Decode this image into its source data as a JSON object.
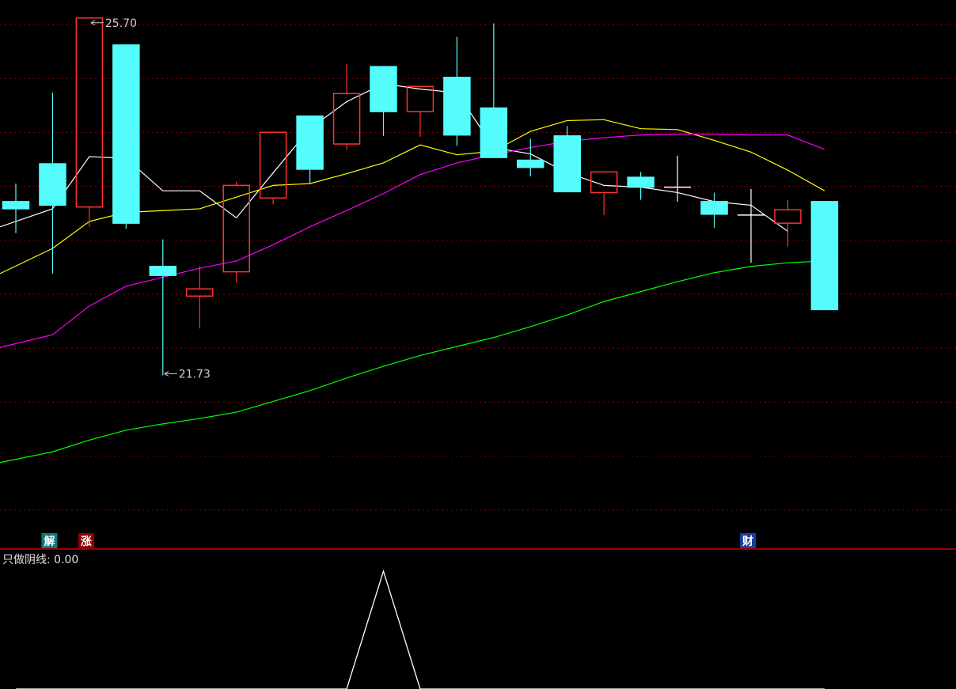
{
  "chart_data": {
    "type": "candlestick",
    "title": "",
    "ylim": [
      19.8,
      25.9
    ],
    "grid": true,
    "colors": {
      "up": "#ff3232",
      "down": "#54fcfc",
      "doji": "#ffffff",
      "ma5": "#ffffff",
      "ma10": "#ffff00",
      "ma20": "#ff00ff",
      "ma60": "#00ff00",
      "grid": "#8b0000",
      "separator": "#c80000",
      "indicator": "#ffffff"
    },
    "candles": [
      {
        "open": 23.66,
        "close": 23.58,
        "high": 23.86,
        "low": 23.31
      },
      {
        "open": 24.08,
        "close": 23.62,
        "high": 24.87,
        "low": 22.86
      },
      {
        "open": 23.6,
        "close": 25.7,
        "high": 25.7,
        "low": 23.38
      },
      {
        "open": 25.4,
        "close": 23.42,
        "high": 25.4,
        "low": 23.36
      },
      {
        "open": 22.94,
        "close": 22.84,
        "high": 23.24,
        "low": 21.73
      },
      {
        "open": 22.61,
        "close": 22.69,
        "high": 22.94,
        "low": 22.25
      },
      {
        "open": 22.88,
        "close": 23.84,
        "high": 23.88,
        "low": 22.76
      },
      {
        "open": 23.7,
        "close": 24.43,
        "high": 24.43,
        "low": 23.63
      },
      {
        "open": 24.61,
        "close": 24.02,
        "high": 24.61,
        "low": 23.86
      },
      {
        "open": 24.3,
        "close": 24.86,
        "high": 25.19,
        "low": 24.24
      },
      {
        "open": 25.16,
        "close": 24.66,
        "high": 25.16,
        "low": 24.39
      },
      {
        "open": 24.66,
        "close": 24.94,
        "high": 24.94,
        "low": 24.38
      },
      {
        "open": 25.04,
        "close": 24.4,
        "high": 25.49,
        "low": 24.28
      },
      {
        "open": 24.7,
        "close": 24.15,
        "high": 25.64,
        "low": 24.15
      },
      {
        "open": 24.12,
        "close": 24.04,
        "high": 24.36,
        "low": 23.94
      },
      {
        "open": 24.39,
        "close": 23.77,
        "high": 24.5,
        "low": 23.77
      },
      {
        "open": 23.76,
        "close": 23.99,
        "high": 23.99,
        "low": 23.51
      },
      {
        "open": 23.93,
        "close": 23.82,
        "high": 23.99,
        "low": 23.68
      },
      {
        "open": 23.82,
        "close": 23.82,
        "high": 24.17,
        "low": 23.66
      },
      {
        "open": 23.66,
        "close": 23.52,
        "high": 23.76,
        "low": 23.37
      },
      {
        "open": 23.51,
        "close": 23.51,
        "high": 23.8,
        "low": 22.98
      },
      {
        "open": 23.42,
        "close": 23.57,
        "high": 23.68,
        "low": 23.16
      },
      {
        "open": 23.66,
        "close": 22.46,
        "high": 23.66,
        "low": 22.46
      }
    ],
    "series": [
      {
        "key": "ma5",
        "values": [
          23.38,
          23.58,
          24.16,
          24.14,
          23.78,
          23.78,
          23.48,
          23.98,
          24.47,
          24.77,
          24.97,
          24.91,
          24.87,
          24.26,
          24.19,
          23.98,
          23.84,
          23.82,
          23.76,
          23.66,
          23.62,
          23.33
        ]
      },
      {
        "key": "ma10",
        "values": [
          22.86,
          23.14,
          23.44,
          23.54,
          23.56,
          23.58,
          23.71,
          23.84,
          23.86,
          23.97,
          24.09,
          24.29,
          24.18,
          24.22,
          24.44,
          24.56,
          24.57,
          24.47,
          24.46,
          24.34,
          24.21,
          24.01,
          23.78
        ]
      },
      {
        "key": "ma20",
        "values": [
          22.04,
          22.18,
          22.5,
          22.72,
          22.82,
          22.92,
          23.0,
          23.18,
          23.38,
          23.56,
          23.75,
          23.96,
          24.09,
          24.18,
          24.26,
          24.33,
          24.37,
          24.4,
          24.41,
          24.41,
          24.4,
          24.4,
          24.24
        ]
      },
      {
        "key": "ma60",
        "values": [
          20.76,
          20.88,
          21.01,
          21.12,
          21.19,
          21.25,
          21.32,
          21.44,
          21.56,
          21.7,
          21.83,
          21.95,
          22.05,
          22.15,
          22.27,
          22.4,
          22.55,
          22.66,
          22.77,
          22.87,
          22.94,
          22.98,
          23.0
        ]
      }
    ],
    "annotations": {
      "high_label": "25.70",
      "low_label": "21.73"
    },
    "signals": [
      {
        "index": 1,
        "text": "解",
        "color": "#0a7a7a"
      },
      {
        "index": 2,
        "text": "涨",
        "color": "#8b0000"
      },
      {
        "index": 20,
        "text": "财",
        "color": "#1a3fa0"
      }
    ],
    "indicator": {
      "label": "只做阴线: 0.00",
      "values": [
        0,
        0,
        0,
        0,
        0,
        0,
        0,
        0,
        0,
        0,
        1,
        0,
        0,
        0,
        0,
        0,
        0,
        0,
        0,
        0,
        0,
        0,
        0
      ]
    }
  }
}
